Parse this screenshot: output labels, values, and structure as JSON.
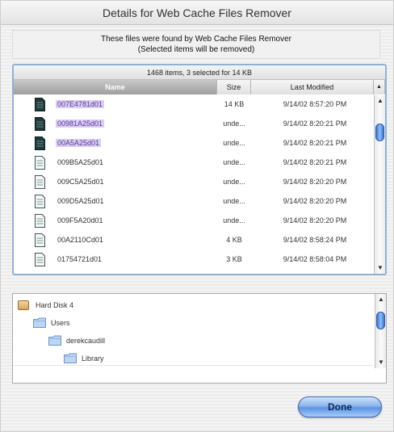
{
  "window": {
    "title": "Details for Web Cache Files Remover"
  },
  "notice": {
    "line1": "These files were found by Web Cache Files Remover",
    "line2": "(Selected items will be removed)"
  },
  "file_list": {
    "summary": "1468 items, 3 selected for 14 KB",
    "columns": {
      "name": "Name",
      "size": "Size",
      "modified": "Last Modified"
    },
    "rows": [
      {
        "name": "007E4781d01",
        "size": "14 KB",
        "modified": "9/14/02 8:57:20 PM",
        "selected": true,
        "icon": "document-dark-icon"
      },
      {
        "name": "00981A25d01",
        "size": "unde...",
        "modified": "9/14/02 8:20:21 PM",
        "selected": true,
        "icon": "document-dark-icon"
      },
      {
        "name": "00A5A25d01",
        "size": "unde...",
        "modified": "9/14/02 8:20:21 PM",
        "selected": true,
        "icon": "document-dark-icon"
      },
      {
        "name": "009B5A25d01",
        "size": "unde...",
        "modified": "9/14/02 8:20:21 PM",
        "selected": false,
        "icon": "document-icon"
      },
      {
        "name": "009C5A25d01",
        "size": "unde...",
        "modified": "9/14/02 8:20:20 PM",
        "selected": false,
        "icon": "document-icon"
      },
      {
        "name": "009D5A25d01",
        "size": "unde...",
        "modified": "9/14/02 8:20:20 PM",
        "selected": false,
        "icon": "document-icon"
      },
      {
        "name": "009F5A20d01",
        "size": "unde...",
        "modified": "9/14/02 8:20:20 PM",
        "selected": false,
        "icon": "document-icon"
      },
      {
        "name": "00A2110Cd01",
        "size": "4 KB",
        "modified": "9/14/02 8:58:24 PM",
        "selected": false,
        "icon": "document-icon"
      },
      {
        "name": "01754721d01",
        "size": "3 KB",
        "modified": "9/14/02 8:58:04 PM",
        "selected": false,
        "icon": "document-icon"
      }
    ],
    "scroll_position": 0.12
  },
  "path_tree": {
    "items": [
      {
        "label": "Hard Disk 4",
        "icon": "hard-disk-icon"
      },
      {
        "label": "Users",
        "icon": "folder-icon"
      },
      {
        "label": "derekcaudill",
        "icon": "folder-icon"
      },
      {
        "label": "Library",
        "icon": "folder-icon"
      }
    ],
    "scroll_position": 0.2
  },
  "buttons": {
    "done": "Done"
  },
  "colors": {
    "selection_highlight": "#d9cdf2",
    "selection_text": "#5a3e9a",
    "panel_focus_border": "#8fb1d6",
    "done_button": "#8bb4ec"
  }
}
